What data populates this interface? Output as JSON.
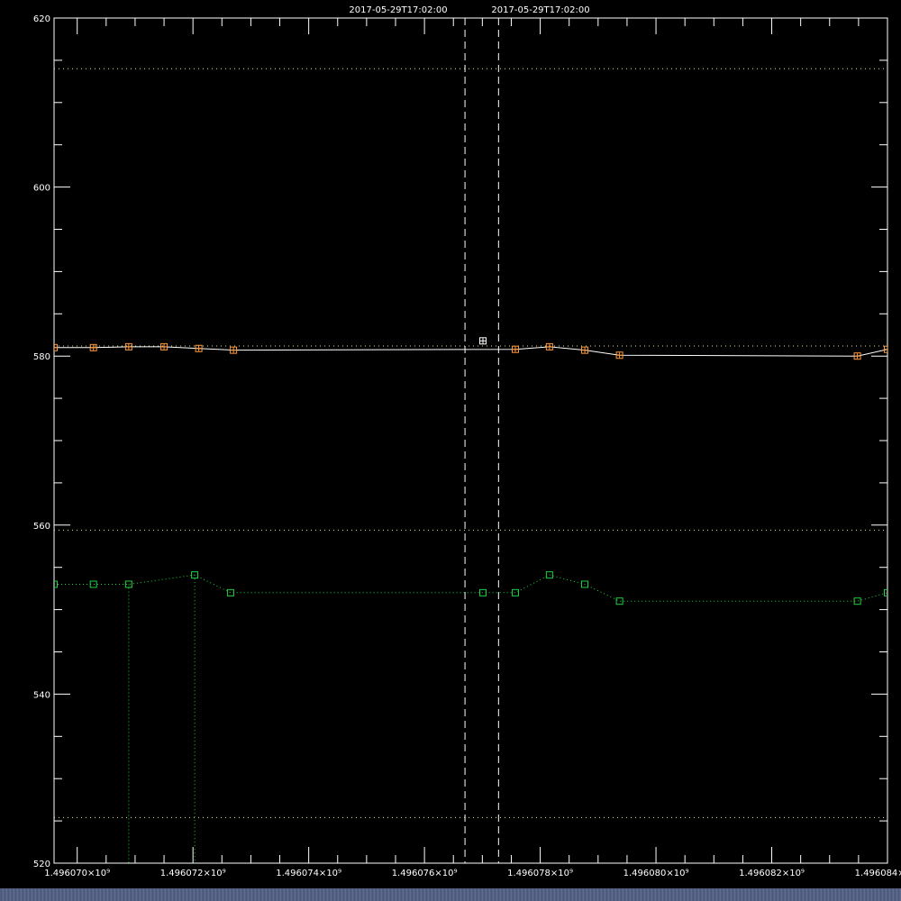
{
  "header": {
    "time_left": "2017-05-29T17:02:00",
    "time_right": "2017-05-29T17:02:00"
  },
  "chart_data": {
    "type": "line",
    "title": "",
    "xlabel": "",
    "ylabel": "",
    "xlim": [
      1496069600,
      1496084000
    ],
    "ylim": [
      520,
      620
    ],
    "x_tick_values": [
      1496070000,
      1496072000,
      1496074000,
      1496076000,
      1496078000,
      1496080000,
      1496082000,
      1496084000
    ],
    "x_tick_labels": [
      "1.496070×10⁹",
      "1.496072×10⁹",
      "1.496074×10⁹",
      "1.496076×10⁹",
      "1.496078×10⁹",
      "1.496080×10⁹",
      "1.496082×10⁹",
      "1.496084×10⁹"
    ],
    "y_tick_values": [
      520,
      540,
      560,
      580,
      600,
      620
    ],
    "y_tick_labels": [
      "520",
      "540",
      "560",
      "580",
      "600",
      "620"
    ],
    "y_minor_step": 5,
    "grid": false,
    "vertical_markers": [
      1496076700,
      1496077280
    ],
    "reference_lines": [
      {
        "y": 614.0,
        "color": "#d8e8a0"
      },
      {
        "y": 581.2,
        "color": "#d8e8a0"
      },
      {
        "y": 559.4,
        "color": "#d8e8a0"
      },
      {
        "y": 525.4,
        "color": "#d8e8a0"
      }
    ],
    "series": [
      {
        "color": "#ffffff",
        "marker_color": "#ff9a3c",
        "line_style": "solid",
        "x": [
          1496069600,
          1496070280,
          1496070890,
          1496071500,
          1496072100,
          1496072700,
          1496077570,
          1496078160,
          1496078770,
          1496079370,
          1496083480,
          1496084000
        ],
        "y": [
          581.0,
          581.0,
          581.1,
          581.1,
          580.9,
          580.7,
          580.8,
          581.1,
          580.7,
          580.1,
          580.0,
          580.8
        ]
      },
      {
        "color": "#20d040",
        "marker_color": "#20d040",
        "line_style": "dotted",
        "x": [
          1496069600,
          1496070280,
          1496070890,
          1496072030,
          1496072650,
          1496077010,
          1496077570,
          1496078160,
          1496078770,
          1496079370,
          1496083480,
          1496084000
        ],
        "y": [
          553.0,
          553.0,
          553.0,
          554.1,
          552.0,
          552.0,
          552.0,
          554.1,
          553.0,
          551.0,
          551.0,
          552.0
        ]
      }
    ],
    "highlight_point": {
      "x": 1496077010,
      "y": 581.8,
      "color": "#ffffff"
    },
    "drops": [
      {
        "x": 1496070890,
        "from_y": 553.0
      },
      {
        "x": 1496072030,
        "from_y": 554.1
      }
    ]
  }
}
